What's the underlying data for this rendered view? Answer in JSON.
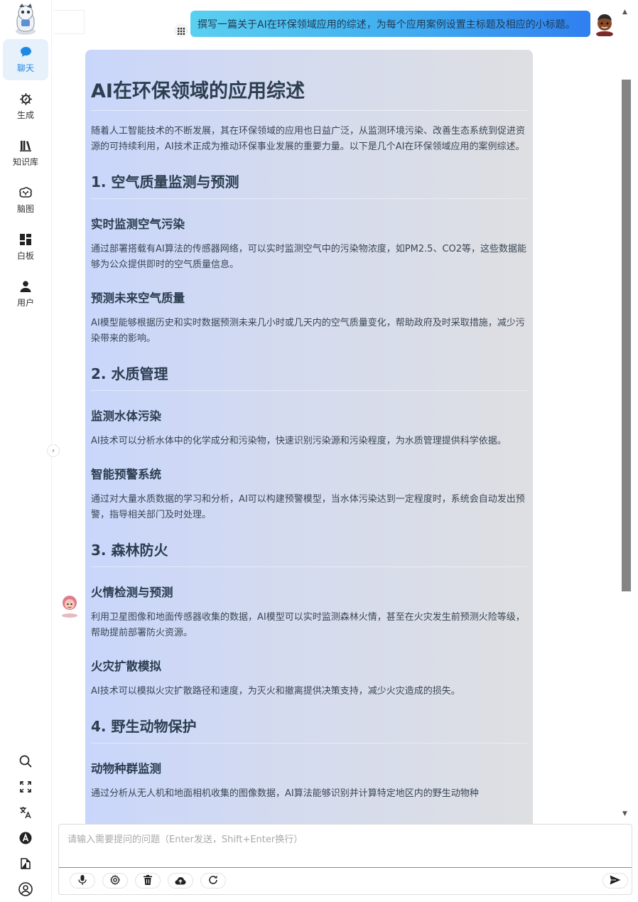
{
  "sidebar": {
    "items": [
      {
        "label": "聊天",
        "icon": "chat-bubble-icon",
        "active": true
      },
      {
        "label": "生成",
        "icon": "generate-icon",
        "active": false
      },
      {
        "label": "知识库",
        "icon": "library-icon",
        "active": false
      },
      {
        "label": "脑图",
        "icon": "brain-icon",
        "active": false
      },
      {
        "label": "白板",
        "icon": "whiteboard-icon",
        "active": false
      },
      {
        "label": "用户",
        "icon": "user-icon",
        "active": false
      }
    ],
    "tools": [
      "search-icon",
      "fullscreen-icon",
      "translate-icon",
      "font-icon",
      "theme-icon",
      "account-icon"
    ]
  },
  "chat": {
    "user_message": "撰写一篇关于AI在环保领域应用的综述，为每个应用案例设置主标题及相应的小标题。",
    "answer": {
      "title": "AI在环保领域的应用综述",
      "intro": "随着人工智能技术的不断发展，其在环保领域的应用也日益广泛，从监测环境污染、改善生态系统到促进资源的可持续利用，AI技术正成为推动环保事业发展的重要力量。以下是几个AI在环保领域应用的案例综述。",
      "sections": [
        {
          "heading": "1. 空气质量监测与预测",
          "subsections": [
            {
              "title": "实时监测空气污染",
              "text": "通过部署搭载有AI算法的传感器网络，可以实时监测空气中的污染物浓度，如PM2.5、CO2等，这些数据能够为公众提供即时的空气质量信息。"
            },
            {
              "title": "预测未来空气质量",
              "text": "AI模型能够根据历史和实时数据预测未来几小时或几天内的空气质量变化，帮助政府及时采取措施，减少污染带来的影响。"
            }
          ]
        },
        {
          "heading": "2. 水质管理",
          "subsections": [
            {
              "title": "监测水体污染",
              "text": "AI技术可以分析水体中的化学成分和污染物，快速识别污染源和污染程度，为水质管理提供科学依据。"
            },
            {
              "title": "智能预警系统",
              "text": "通过对大量水质数据的学习和分析，AI可以构建预警模型，当水体污染达到一定程度时，系统会自动发出预警，指导相关部门及时处理。"
            }
          ]
        },
        {
          "heading": "3. 森林防火",
          "subsections": [
            {
              "title": "火情检测与预测",
              "text": "利用卫星图像和地面传感器收集的数据，AI模型可以实时监测森林火情，甚至在火灾发生前预测火险等级，帮助提前部署防火资源。"
            },
            {
              "title": "火灾扩散模拟",
              "text": "AI技术可以模拟火灾扩散路径和速度，为灭火和撤离提供决策支持，减少火灾造成的损失。"
            }
          ]
        },
        {
          "heading": "4. 野生动物保护",
          "subsections": [
            {
              "title": "动物种群监测",
              "text": "通过分析从无人机和地面相机收集的图像数据，AI算法能够识别并计算特定地区内的野生动物种"
            }
          ]
        }
      ]
    }
  },
  "input": {
    "placeholder": "请输入需要提问的问题（Enter发送，Shift+Enter换行）",
    "value": "",
    "buttons": [
      "microphone-icon",
      "settings-icon",
      "delete-icon",
      "upload-cloud-icon",
      "refresh-icon"
    ],
    "send_icon": "send-icon"
  },
  "colors": {
    "accent": "#1e88e5",
    "active_nav_bg": "#e6f1fc",
    "user_bubble_start": "#5ad0f0",
    "user_bubble_end": "#2f7ff0"
  }
}
